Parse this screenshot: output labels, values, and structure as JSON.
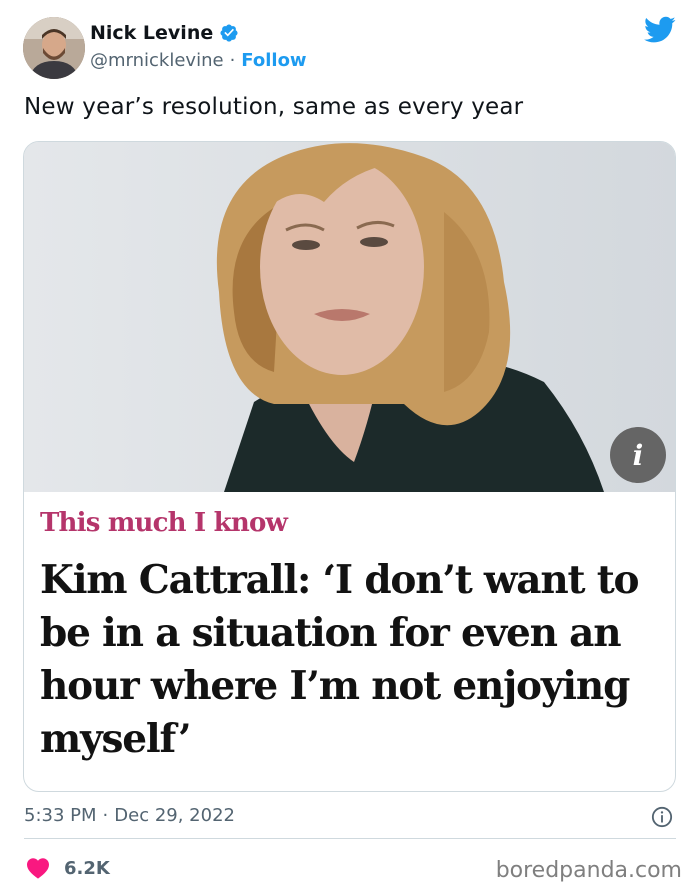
{
  "author": {
    "name": "Nick Levine",
    "handle": "@mrnicklevine",
    "separator": "·",
    "follow_label": "Follow"
  },
  "tweet": {
    "text": "New year’s resolution, same as every year"
  },
  "card": {
    "kicker": "This much I know",
    "headline": "Kim Cattrall: ‘I don’t want to be in a situation for even an hour where I’m not enjoying myself’",
    "info_badge": "i",
    "kicker_color": "#b5356b"
  },
  "meta": {
    "time": "5:33 PM",
    "separator": "·",
    "date": "Dec 29, 2022"
  },
  "engagement": {
    "likes": "6.2K"
  },
  "watermark": "boredpanda.com",
  "colors": {
    "twitter_blue": "#1d9bf0",
    "like_red": "#f91880",
    "secondary_text": "#536471"
  },
  "icons": [
    "verified-badge-icon",
    "twitter-bird-icon",
    "info-circle-icon",
    "heart-icon"
  ]
}
